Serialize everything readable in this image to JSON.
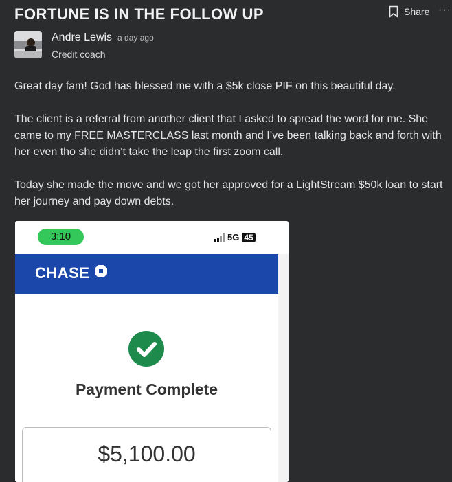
{
  "post": {
    "title": "FORTUNE IS IN THE FOLLOW UP",
    "share_label": "Share",
    "more_label": "···",
    "author": {
      "name": "Andre Lewis",
      "time": "a day ago",
      "role": "Credit coach"
    },
    "paragraphs": [
      "Great day fam! God has blessed me with a $5k close PIF on this beautiful day.",
      "The client is a referral from another client that I asked to spread the word for me. She came to my FREE MASTERCLASS last month and I’ve been talking back and forth with her even tho she didn’t take the leap the first zoom call.",
      "Today she made the move and we got her approved for a LightStream $50k loan to start her journey and pay down debts."
    ]
  },
  "screenshot": {
    "status_time": "3:10",
    "network": "5G",
    "battery": "45",
    "bank_name": "CHASE",
    "payment_status": "Payment Complete",
    "amount": "$5,100.00",
    "colors": {
      "chase_blue": "#1a47a9",
      "check_green": "#1e8a4c",
      "time_pill_green": "#34c759"
    }
  }
}
